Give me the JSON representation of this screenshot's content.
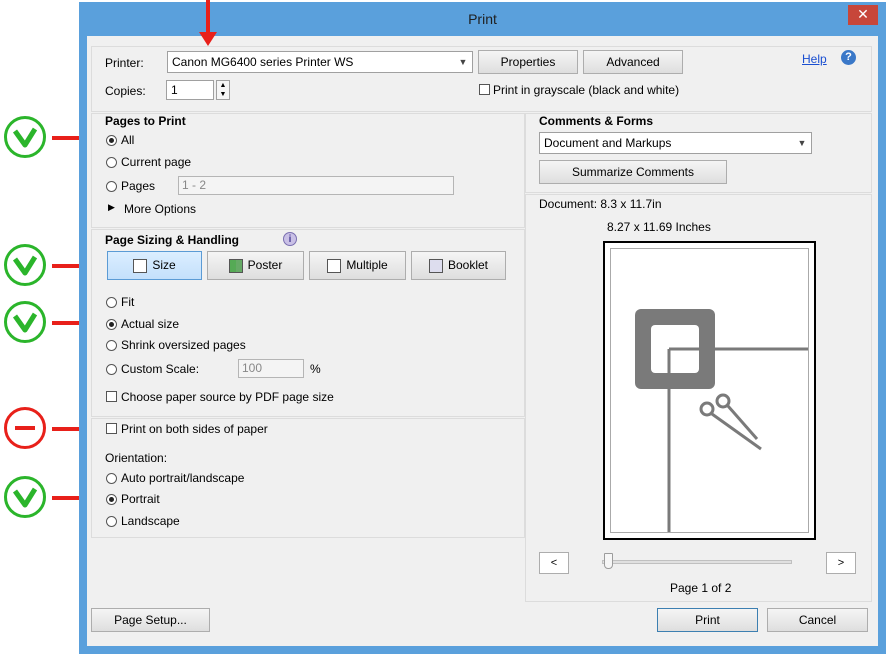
{
  "window": {
    "title": "Print",
    "close": "✕"
  },
  "printer": {
    "label": "Printer:",
    "value": "Canon MG6400 series Printer WS",
    "properties": "Properties",
    "advanced": "Advanced",
    "help": "Help"
  },
  "copies": {
    "label": "Copies:",
    "value": "1"
  },
  "grayscale": {
    "label": "Print in grayscale (black and white)",
    "checked": false
  },
  "pages_to_print": {
    "heading": "Pages to Print",
    "all": "All",
    "current": "Current page",
    "pages": "Pages",
    "pages_value": "1 - 2",
    "more": "More Options",
    "selected": "All"
  },
  "sizing": {
    "heading": "Page Sizing & Handling",
    "tabs": [
      "Size",
      "Poster",
      "Multiple",
      "Booklet"
    ],
    "selected_tab": "Size",
    "fit": "Fit",
    "actual": "Actual size",
    "shrink": "Shrink oversized pages",
    "custom": "Custom Scale:",
    "custom_value": "100",
    "percent": "%",
    "paper_source": "Choose paper source by PDF page size",
    "selected": "Actual size"
  },
  "duplex": {
    "label": "Print on both sides of paper",
    "checked": false
  },
  "orientation": {
    "heading": "Orientation:",
    "auto": "Auto portrait/landscape",
    "portrait": "Portrait",
    "landscape": "Landscape",
    "selected": "Portrait"
  },
  "comments": {
    "heading": "Comments & Forms",
    "value": "Document and Markups",
    "summarize": "Summarize Comments"
  },
  "preview": {
    "document": "Document: 8.3 x 11.7in",
    "size": "8.27 x 11.69 Inches",
    "prev": "<",
    "next": ">",
    "page": "Page 1 of 2",
    "slider_fraction": 0.0
  },
  "footer": {
    "page_setup": "Page Setup...",
    "print": "Print",
    "cancel": "Cancel"
  },
  "annotations": {
    "check_color": "#2bb52b",
    "minus_color": "#e8201a",
    "arrow_color": "#e8201a"
  }
}
